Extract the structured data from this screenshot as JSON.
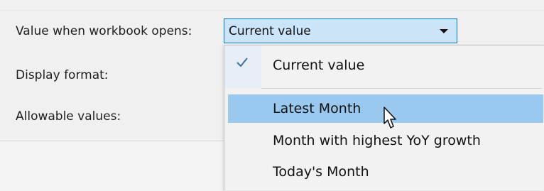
{
  "form": {
    "open_label": "Value when workbook opens:",
    "format_label": "Display format:",
    "allowable_label": "Allowable values:"
  },
  "combo": {
    "selected_value": "Current value",
    "arrow_icon": "dropdown-arrow-icon"
  },
  "dropdown": {
    "items": [
      {
        "label": "Current value",
        "checked": true
      },
      {
        "label": "Latest Month",
        "hovered": true
      },
      {
        "label": "Month with highest YoY growth"
      },
      {
        "label": "Today's Month"
      }
    ],
    "check_icon": "checkmark-icon",
    "cursor_icon": "mouse-pointer-icon"
  },
  "colors": {
    "combo_background": "#cce4f7",
    "combo_border": "#0078d7",
    "hover_background": "#99c9ef",
    "check_color": "#3a6ea5"
  }
}
